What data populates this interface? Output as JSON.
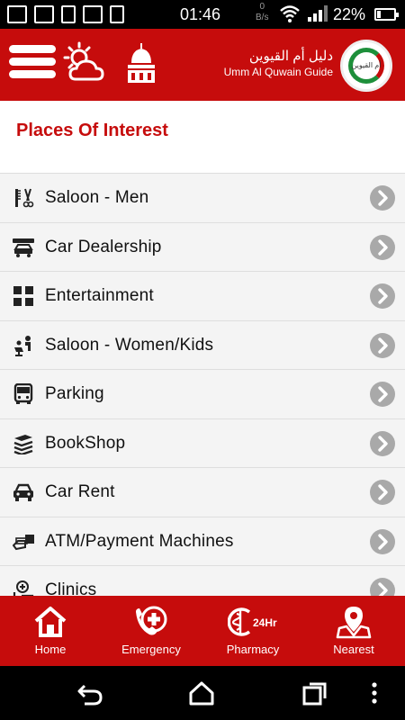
{
  "status_bar": {
    "time": "01:46",
    "data_rate_value": "0",
    "data_rate_unit": "B/s",
    "battery": "22%",
    "battery_level": 0.22
  },
  "header": {
    "brand_arabic": "دليل أم القيوين",
    "brand_english": "Umm Al Quwain Guide",
    "logo_text": "أم القيوين",
    "icons": [
      "menu-icon",
      "weather-icon",
      "mosque-icon"
    ],
    "accent_color": "#c60c0c"
  },
  "main": {
    "title": "Places Of Interest",
    "items": [
      {
        "label": "Saloon - Men",
        "icon": "scissors-comb-icon"
      },
      {
        "label": "Car Dealership",
        "icon": "car-dealer-icon"
      },
      {
        "label": "Entertainment",
        "icon": "grid-icon"
      },
      {
        "label": "Saloon - Women/Kids",
        "icon": "salon-chair-icon"
      },
      {
        "label": "Parking",
        "icon": "bus-icon"
      },
      {
        "label": "BookShop",
        "icon": "books-icon"
      },
      {
        "label": "Car Rent",
        "icon": "car-icon"
      },
      {
        "label": "ATM/Payment Machines",
        "icon": "atm-icon"
      },
      {
        "label": "Clinics",
        "icon": "clinic-icon"
      }
    ]
  },
  "tabbar": {
    "tabs": [
      {
        "label": "Home",
        "icon": "home-icon"
      },
      {
        "label": "Emergency",
        "icon": "emergency-icon"
      },
      {
        "label": "Pharmacy",
        "icon": "pharmacy-icon",
        "badge": "24Hr"
      },
      {
        "label": "Nearest",
        "icon": "location-pin-icon"
      }
    ]
  },
  "system_nav": {
    "buttons": [
      "back-icon",
      "home-outline-icon",
      "recents-icon",
      "overflow-menu-icon"
    ]
  }
}
